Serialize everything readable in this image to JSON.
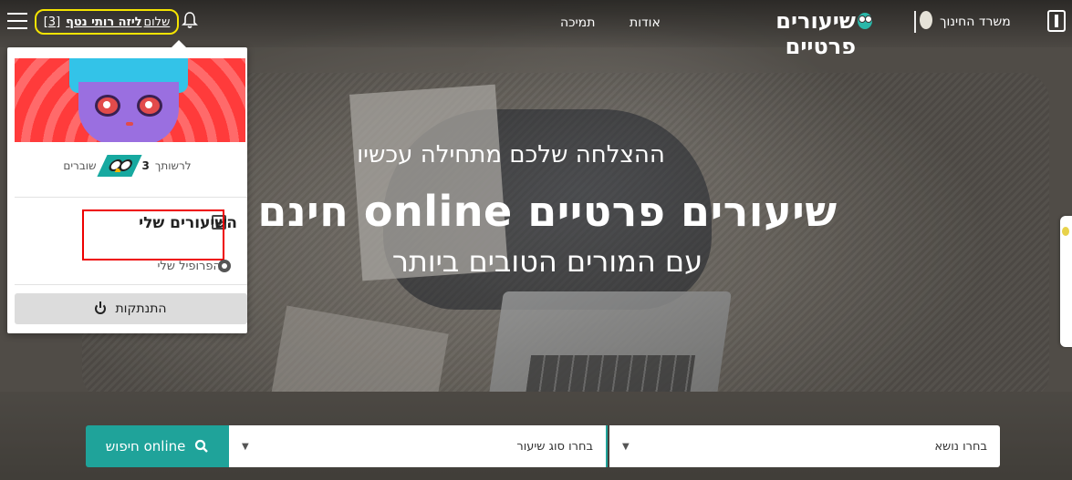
{
  "header": {
    "greeting_prefix": "שלום",
    "user_name": "ליזה רותי נטף",
    "notif_count": "[3]",
    "nav": {
      "support": "תמיכה",
      "about": "אודות"
    },
    "brand": "שיעורים פרטיים",
    "ministry": "משרד החינוך"
  },
  "hero": {
    "line1": "ההצלחה שלכם מתחילה עכשיו",
    "line2": "שיעורים פרטיים online חינם",
    "line3": "עם המורים הטובים ביותר"
  },
  "menu": {
    "coins_prefix": "לרשותך",
    "coins_count": "3",
    "coins_suffix": "שוברים",
    "my_lessons": "השיעורים שלי",
    "my_profile": "הפרופיל שלי",
    "logout": "התנתקות"
  },
  "search": {
    "button": "חיפוש online",
    "lesson_type_placeholder": "בחרו סוג שיעור",
    "subject_placeholder": "בחרו נושא"
  },
  "colors": {
    "accent": "#1fa39a",
    "highlight_box": "#f5e400",
    "red_box": "#ee0000"
  },
  "icons": [
    "hamburger-icon",
    "bell-icon",
    "owl-logo-icon",
    "emblem-icon",
    "calendar-check-icon",
    "gear-icon",
    "power-icon",
    "search-icon",
    "chevron-down-icon"
  ]
}
